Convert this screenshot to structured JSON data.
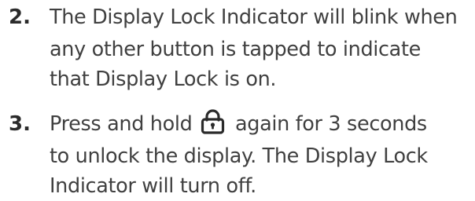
{
  "steps": [
    {
      "number": "2.",
      "lines": [
        "The Display Lock Indicator will blink when",
        "any other button is tapped to indicate",
        "that Display Lock is on."
      ]
    },
    {
      "number": "3.",
      "line1_before_icon": "Press and hold",
      "icon": "lock-icon",
      "line1_after_icon": "again for 3 seconds",
      "lines": [
        "to unlock the display. The Display Lock",
        "Indicator will turn off."
      ]
    }
  ],
  "colors": {
    "text": "#404040",
    "number": "#2b2b2b"
  }
}
